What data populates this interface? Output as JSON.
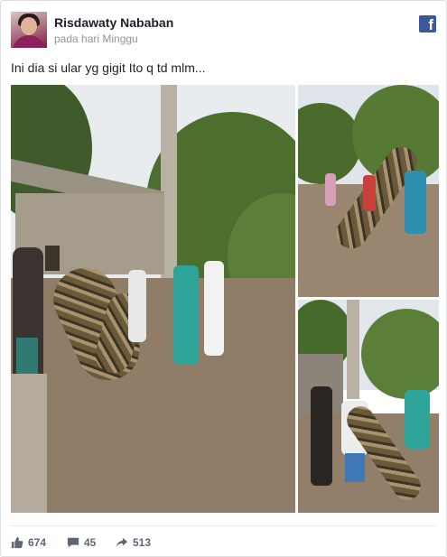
{
  "post": {
    "author": "Risdawaty Nababan",
    "timestamp": "pada hari Minggu",
    "text": "Ini dia si ular yg gigit Ito q td mlm...",
    "network_icon": "facebook-icon"
  },
  "footer": {
    "likes": "674",
    "comments": "45",
    "shares": "513",
    "like_icon": "thumbs-up-icon",
    "comment_icon": "comment-bubble-icon",
    "share_icon": "share-arrow-icon"
  },
  "colors": {
    "brand": "#3b5998",
    "text": "#1d2129",
    "muted": "#90949c",
    "footer_text": "#606770"
  }
}
